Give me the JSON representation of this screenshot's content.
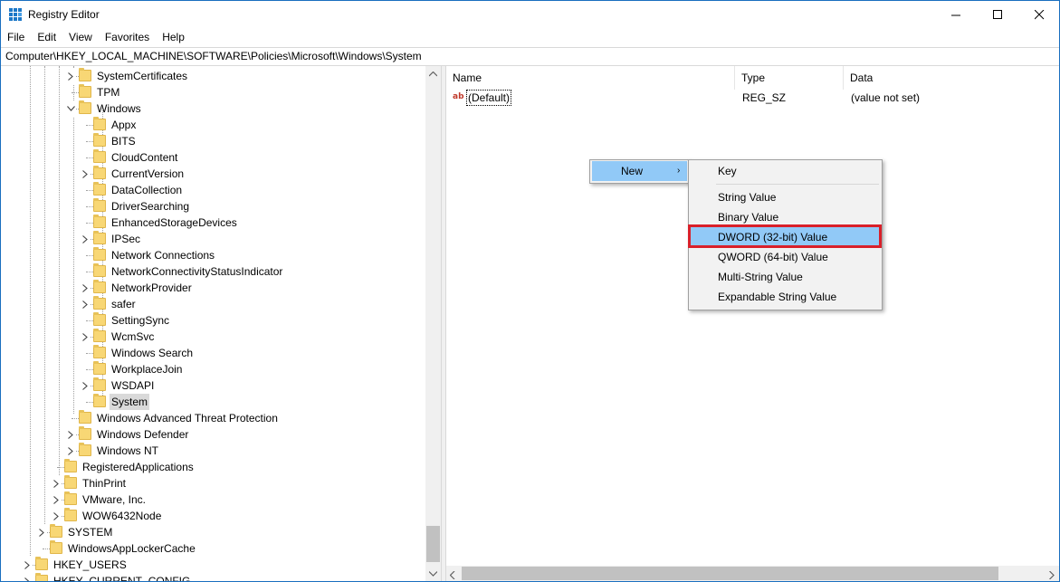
{
  "window": {
    "title": "Registry Editor"
  },
  "menu": [
    "File",
    "Edit",
    "View",
    "Favorites",
    "Help"
  ],
  "address": "Computer\\HKEY_LOCAL_MACHINE\\SOFTWARE\\Policies\\Microsoft\\Windows\\System",
  "tree": {
    "items": [
      {
        "label": "SystemCertificates",
        "expandable": true
      },
      {
        "label": "TPM",
        "expandable": false
      },
      {
        "label": "Windows",
        "expandable": true,
        "expanded": true
      },
      {
        "label": "Appx",
        "expandable": false
      },
      {
        "label": "BITS",
        "expandable": false
      },
      {
        "label": "CloudContent",
        "expandable": false
      },
      {
        "label": "CurrentVersion",
        "expandable": true
      },
      {
        "label": "DataCollection",
        "expandable": false
      },
      {
        "label": "DriverSearching",
        "expandable": false
      },
      {
        "label": "EnhancedStorageDevices",
        "expandable": false
      },
      {
        "label": "IPSec",
        "expandable": true
      },
      {
        "label": "Network Connections",
        "expandable": false
      },
      {
        "label": "NetworkConnectivityStatusIndicator",
        "expandable": false
      },
      {
        "label": "NetworkProvider",
        "expandable": true
      },
      {
        "label": "safer",
        "expandable": true
      },
      {
        "label": "SettingSync",
        "expandable": false
      },
      {
        "label": "WcmSvc",
        "expandable": true
      },
      {
        "label": "Windows Search",
        "expandable": false
      },
      {
        "label": "WorkplaceJoin",
        "expandable": false
      },
      {
        "label": "WSDAPI",
        "expandable": true
      },
      {
        "label": "System",
        "expandable": false,
        "selected": true
      },
      {
        "label": "Windows Advanced Threat Protection",
        "expandable": false
      },
      {
        "label": "Windows Defender",
        "expandable": true
      },
      {
        "label": "Windows NT",
        "expandable": true
      },
      {
        "label": "RegisteredApplications",
        "expandable": false
      },
      {
        "label": "ThinPrint",
        "expandable": true
      },
      {
        "label": "VMware, Inc.",
        "expandable": true
      },
      {
        "label": "WOW6432Node",
        "expandable": true
      },
      {
        "label": "SYSTEM",
        "expandable": true
      },
      {
        "label": "WindowsAppLockerCache",
        "expandable": false
      },
      {
        "label": "HKEY_USERS",
        "expandable": true
      },
      {
        "label": "HKEY_CURRENT_CONFIG",
        "expandable": true
      }
    ]
  },
  "values": {
    "columns": [
      "Name",
      "Type",
      "Data"
    ],
    "rows": [
      {
        "name": "(Default)",
        "type": "REG_SZ",
        "data": "(value not set)",
        "icon": "string-value-icon"
      }
    ]
  },
  "context_menu": {
    "new_label": "New",
    "submenu": {
      "items": [
        "Key",
        "String Value",
        "Binary Value",
        "DWORD (32-bit) Value",
        "QWORD (64-bit) Value",
        "Multi-String Value",
        "Expandable String Value"
      ],
      "highlighted": "DWORD (32-bit) Value"
    }
  },
  "colors": {
    "selection": "#91c9f7",
    "highlight_box": "#d9202a",
    "folder": "#f8d775"
  }
}
